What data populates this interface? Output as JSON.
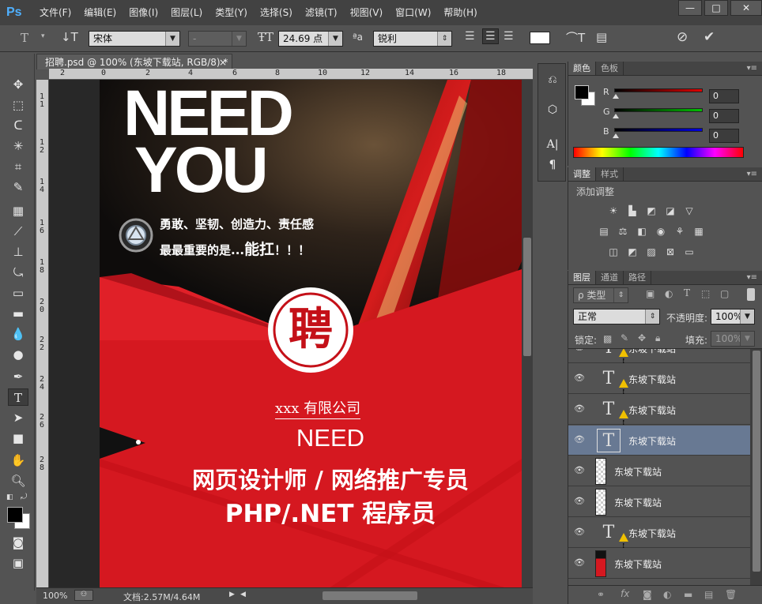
{
  "app": {
    "logo": "Ps"
  },
  "menu": [
    "文件(F)",
    "编辑(E)",
    "图像(I)",
    "图层(L)",
    "类型(Y)",
    "选择(S)",
    "滤镜(T)",
    "视图(V)",
    "窗口(W)",
    "帮助(H)"
  ],
  "window_controls": {
    "minimize": "—",
    "maximize": "□",
    "close": "✕"
  },
  "options": {
    "font_family": "宋体",
    "font_style": "-",
    "font_size": "24.69 点",
    "aa_label": "ªa",
    "antialias": "锐利",
    "color_hex": "#ffffff"
  },
  "document": {
    "tab_title": "招聘.psd @ 100% (东坡下载站, RGB/8) *",
    "tab_close": "×"
  },
  "ruler": {
    "top": [
      "2",
      "0",
      "2",
      "4",
      "6",
      "8",
      "10",
      "12",
      "14",
      "16",
      "18"
    ],
    "left": [
      "1",
      "1",
      "1",
      "2",
      "1",
      "4",
      "1",
      "6",
      "1",
      "8",
      "2",
      "0",
      "2",
      "2",
      "2",
      "4",
      "2",
      "6",
      "2",
      "8"
    ]
  },
  "poster": {
    "headline1": "NEED",
    "headline2": "YOU",
    "slogan1": "勇敢、坚韧、创造力、责任感",
    "slogan2_a": "最最重要的是...",
    "slogan2_b": "能扛",
    "slogan2_c": "！！！",
    "emblem_char": "聘",
    "company": "xxx 有限公司",
    "need": "NEED",
    "job1": "网页设计师 / 网络推广专员",
    "job2": "PHP/.NET 程序员"
  },
  "status": {
    "zoom": "100%",
    "doc_info": "文档:2.57M/4.64M"
  },
  "color_panel": {
    "tabs": [
      "颜色",
      "色板"
    ],
    "channels": [
      {
        "label": "R",
        "value": "0",
        "color": "#e00000"
      },
      {
        "label": "G",
        "value": "0",
        "color": "#00c000"
      },
      {
        "label": "B",
        "value": "0",
        "color": "#0000e0"
      }
    ]
  },
  "adjust_panel": {
    "tabs": [
      "调整",
      "样式"
    ],
    "title": "添加调整"
  },
  "layers_panel": {
    "tabs": [
      "图层",
      "通道",
      "路径"
    ],
    "filter": "ρ 类型",
    "blend": "正常",
    "opacity_label": "不透明度:",
    "opacity": "100%",
    "lock_label": "锁定:",
    "fill_label": "填充:",
    "fill": "100%",
    "layers": [
      {
        "name": "东坡下载站",
        "type": "text",
        "warn": true
      },
      {
        "name": "东坡下载站",
        "type": "text",
        "warn": true
      },
      {
        "name": "东坡下载站",
        "type": "text",
        "warn": true
      },
      {
        "name": "东坡下载站",
        "type": "text",
        "warn": false,
        "selected": true
      },
      {
        "name": "东坡下载站",
        "type": "pixel"
      },
      {
        "name": "东坡下载站",
        "type": "pixel"
      },
      {
        "name": "东坡下载站",
        "type": "text",
        "warn": true
      },
      {
        "name": "东坡下载站",
        "type": "image"
      }
    ]
  }
}
